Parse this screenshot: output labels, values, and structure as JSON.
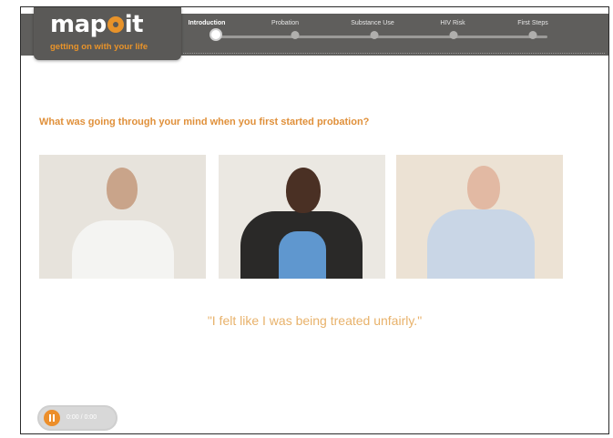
{
  "app": {
    "logo": "mapit",
    "tagline": "getting on with your life"
  },
  "nav": {
    "steps": [
      {
        "label": "Introduction",
        "active": true
      },
      {
        "label": "Probation",
        "active": false
      },
      {
        "label": "Substance Use",
        "active": false
      },
      {
        "label": "HIV Risk",
        "active": false
      },
      {
        "label": "First Steps",
        "active": false
      }
    ],
    "progress": 0
  },
  "main": {
    "question": "What was going through your mind when you first started probation?",
    "quote": "\"I felt like I was being treated unfairly.\"",
    "photos": [
      {
        "alt": "man in white t-shirt",
        "wall": "#e7e3dc",
        "skin": "#c9a48a",
        "shirt": "#f4f4f2"
      },
      {
        "alt": "woman in dark jacket and blue top",
        "wall": "#ebe8e2",
        "skin": "#4a3024",
        "shirt": "#2a2928"
      },
      {
        "alt": "man in light blue shirt",
        "wall": "#ece2d4",
        "skin": "#e2b9a3",
        "shirt": "#c9d6e6"
      }
    ]
  },
  "player": {
    "timecode": "0:00 / 0:00",
    "state": "playing"
  },
  "colors": {
    "accent": "#e8932a",
    "bar": "#5f5e5c"
  }
}
